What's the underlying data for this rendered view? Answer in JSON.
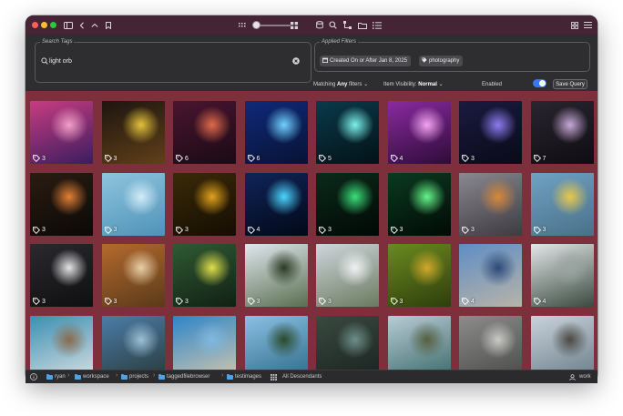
{
  "toolbar": {
    "traffic_lights": [
      "#ff5f57",
      "#febc2e",
      "#28c840"
    ],
    "left_icons": [
      "sidebar-icon",
      "chevron-left-icon",
      "chevron-up-icon",
      "bookmark-icon"
    ],
    "center_icons": [
      "small-grid-icon",
      "large-grid-icon"
    ],
    "slider_level": 0.12,
    "right_tools": [
      "database-icon",
      "search-icon",
      "hierarchy-icon",
      "folder-icon",
      "list-icon"
    ],
    "far_right": [
      "grid-view-icon",
      "list-view-icon"
    ]
  },
  "search": {
    "legend": "Search Tags",
    "value": "light orb"
  },
  "filters": {
    "legend": "Applied Filters",
    "chips": [
      {
        "icon": "calendar-icon",
        "label": "Created On or After Jan 8, 2025"
      },
      {
        "icon": "tag-icon",
        "label": "photography"
      }
    ]
  },
  "controls": {
    "matching_prefix": "Matching",
    "matching_value": "Any",
    "matching_suffix": "filters",
    "visibility_prefix": "Item Visibility:",
    "visibility_value": "Normal",
    "enabled_label": "Enabled",
    "enabled": true,
    "save_query": "Save Query"
  },
  "grid": {
    "background": "#7d2f3c",
    "tiles": [
      {
        "tags": "3",
        "c1": "#c83c82",
        "c2": "#3a1d5e",
        "c3": "#f2a0c8"
      },
      {
        "tags": "3",
        "c1": "#1d1510",
        "c2": "#604018",
        "c3": "#e3c33b"
      },
      {
        "tags": "6",
        "c1": "#4a1530",
        "c2": "#1a0a14",
        "c3": "#e06a4a"
      },
      {
        "tags": "6",
        "c1": "#0f2a7a",
        "c2": "#081233",
        "c3": "#6fd2ff"
      },
      {
        "tags": "5",
        "c1": "#0a3a4a",
        "c2": "#031217",
        "c3": "#7cf2ea"
      },
      {
        "tags": "4",
        "c1": "#8a2aa0",
        "c2": "#2d0c38",
        "c3": "#f3a5f0"
      },
      {
        "tags": "3",
        "c1": "#1a1a40",
        "c2": "#0a0a18",
        "c3": "#8d7cf0"
      },
      {
        "tags": "7",
        "c1": "#2a2530",
        "c2": "#0e0d12",
        "c3": "#c7a8d8"
      },
      {
        "tags": "3",
        "c1": "#2a1c12",
        "c2": "#0c0806",
        "c3": "#e28035"
      },
      {
        "tags": "3",
        "c1": "#8ec4de",
        "c2": "#4f93b8",
        "c3": "#d2ecf7"
      },
      {
        "tags": "3",
        "c1": "#3a2a08",
        "c2": "#140d02",
        "c3": "#e2a21e"
      },
      {
        "tags": "4",
        "c1": "#0f2458",
        "c2": "#020817",
        "c3": "#4cd6ff"
      },
      {
        "tags": "3",
        "c1": "#0b2a1a",
        "c2": "#010805",
        "c3": "#3be07a"
      },
      {
        "tags": "3",
        "c1": "#0a3a20",
        "c2": "#010a05",
        "c3": "#66f58a"
      },
      {
        "tags": "3",
        "c1": "#8a8890",
        "c2": "#3d3a40",
        "c3": "#d8873a"
      },
      {
        "tags": "3",
        "c1": "#6fa2c2",
        "c2": "#4a7089",
        "c3": "#e8c84a"
      },
      {
        "tags": "3",
        "c1": "#2a2a2e",
        "c2": "#0f0f12",
        "c3": "#e5e5e8"
      },
      {
        "tags": "3",
        "c1": "#b46a2e",
        "c2": "#5a3a1a",
        "c3": "#e8d0a8"
      },
      {
        "tags": "3",
        "c1": "#2f5a32",
        "c2": "#122015",
        "c3": "#e0e04a"
      },
      {
        "tags": "3",
        "c1": "#dfe7ee",
        "c2": "#5a6e50",
        "c3": "#2c3a24"
      },
      {
        "tags": "3",
        "c1": "#cfd6dc",
        "c2": "#6a7a60",
        "c3": "#f0f2f4"
      },
      {
        "tags": "3",
        "c1": "#6a8a20",
        "c2": "#2e3e0c",
        "c3": "#d2a82a"
      },
      {
        "tags": "4",
        "c1": "#5e8ec4",
        "c2": "#b9b3a8",
        "c3": "#2d4a78"
      },
      {
        "tags": "4",
        "c1": "#e3e6e8",
        "c2": "#3a4a40",
        "c3": "#9aa4a0"
      },
      {
        "tags": "",
        "c1": "#3b8fb3",
        "c2": "#d7dfe2",
        "c3": "#8a6a4e"
      },
      {
        "tags": "",
        "c1": "#4b7da8",
        "c2": "#2a3a3a",
        "c3": "#9cc0d6"
      },
      {
        "tags": "",
        "c1": "#2e85c9",
        "c2": "#d0c6ae",
        "c3": "#7fb8e0"
      },
      {
        "tags": "",
        "c1": "#8bc0e4",
        "c2": "#2e6b8a",
        "c3": "#2a4a2a"
      },
      {
        "tags": "",
        "c1": "#3a4a40",
        "c2": "#1a2220",
        "c3": "#6f8e8a"
      },
      {
        "tags": "",
        "c1": "#b9cbd6",
        "c2": "#3a6a6a",
        "c3": "#556040"
      },
      {
        "tags": "",
        "c1": "#8c8c8a",
        "c2": "#4a4a48",
        "c3": "#c9c9c6"
      },
      {
        "tags": "",
        "c1": "#c9d2da",
        "c2": "#6a7e8a",
        "c3": "#4a4844"
      }
    ]
  },
  "statusbar": {
    "info_icon": "info-icon",
    "path": [
      "ryan",
      "workspace",
      "projects",
      "taggedfilebrowser",
      "testimages"
    ],
    "scope_label": "All Descendants",
    "user": "work"
  }
}
